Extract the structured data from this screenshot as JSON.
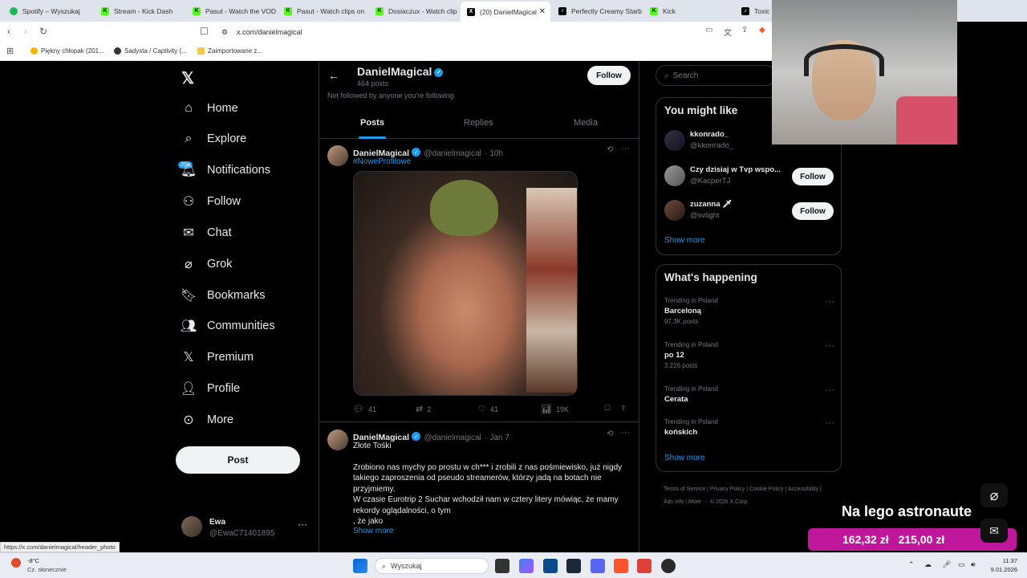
{
  "browser": {
    "tabs": [
      {
        "label": "Spotify – Wyszukaj",
        "color": "#1db954"
      },
      {
        "label": "Stream - Kick Dash",
        "color": "#53fc18"
      },
      {
        "label": "Pasut - Watch the VOD",
        "color": "#53fc18"
      },
      {
        "label": "Pasut - Watch clips on",
        "color": "#53fc18"
      },
      {
        "label": "Dosiaczux - Watch clip",
        "color": "#53fc18"
      },
      {
        "label": "(20) DanielMagical",
        "color": "#000000"
      },
      {
        "label": "Perfectly Creamy Starb",
        "color": "#000000"
      },
      {
        "label": "Kick",
        "color": "#53fc18"
      },
      {
        "label": "Toxic",
        "color": "#000000"
      }
    ],
    "url": "x.com/danielmagical",
    "bookmarks": [
      "Piękny chłopak (201...",
      "Sadysta / Captivity (...",
      "Zaimportowane z..."
    ],
    "status_url": "https://x.com/danielmagical/header_photo"
  },
  "sidebar": {
    "notifications_badge": "20+",
    "items": [
      {
        "label": "Home",
        "icon": "home-icon"
      },
      {
        "label": "Explore",
        "icon": "search-icon"
      },
      {
        "label": "Notifications",
        "icon": "bell-icon"
      },
      {
        "label": "Follow",
        "icon": "person-add-icon"
      },
      {
        "label": "Chat",
        "icon": "mail-icon"
      },
      {
        "label": "Grok",
        "icon": "grok-icon"
      },
      {
        "label": "Bookmarks",
        "icon": "bookmark-icon"
      },
      {
        "label": "Communities",
        "icon": "communities-icon"
      },
      {
        "label": "Premium",
        "icon": "x-logo-icon"
      },
      {
        "label": "Profile",
        "icon": "person-icon"
      },
      {
        "label": "More",
        "icon": "more-icon"
      }
    ],
    "post_button": "Post",
    "account": {
      "name": "Ewa",
      "handle": "@EwaC71401895"
    }
  },
  "profile": {
    "name": "DanielMagical",
    "posts_count": "464 posts",
    "follow_note": "Not followed by anyone you're following",
    "follow_button": "Follow",
    "tabs": [
      "Posts",
      "Replies",
      "Media"
    ]
  },
  "tweets": [
    {
      "name": "DanielMagical",
      "handle": "@danielmagical",
      "time": "· 10h",
      "hashtag": "#NoweProfilowe",
      "replies": "41",
      "reposts": "2",
      "likes": "41",
      "views": "19K"
    },
    {
      "name": "DanielMagical",
      "handle": "@danielmagical",
      "time": "· Jan 7",
      "title": "Złote Tośki",
      "body1": "Zrobiono nas mychy po prostu w ch*** i zrobili z nas pośmiewisko, już nigdy takiego zaproszenia od pseudo streamerów, którzy jadą na botach nie przyjmiemy.",
      "body2": "W czasie Eurotrip 2 Suchar wchodził nam w cztery litery mówiąc, że mamy rekordy oglądalności, o tym",
      "body3": ", że jako",
      "show_more": "Show more"
    }
  ],
  "right": {
    "search_placeholder": "Search",
    "you_might_like": "You might like",
    "suggestions": [
      {
        "name": "kkonrado_",
        "handle": "@kkonrado_"
      },
      {
        "name": "Czy dzisiaj w Tvp wspo...",
        "handle": "@KacperTJ",
        "button": "Follow"
      },
      {
        "name": "zuzanna 🗡",
        "handle": "@svlight",
        "button": "Follow"
      }
    ],
    "show_more": "Show more",
    "whats_happening": "What's happening",
    "trends": [
      {
        "context": "Trending in Poland",
        "topic": "Barceloną",
        "count": "97.3K posts"
      },
      {
        "context": "Trending in Poland",
        "topic": "po 12",
        "count": "3,226 posts"
      },
      {
        "context": "Trending in Poland",
        "topic": "Cerata",
        "count": ""
      },
      {
        "context": "Trending in Poland",
        "topic": "końskich",
        "count": ""
      }
    ],
    "show_more_2": "Show more",
    "footer": "Terms of Service | Privacy Policy | Cookie Policy | Accessibility | Ads info | More ··· © 2026 X Corp."
  },
  "overlay": {
    "donation_title": "Na lego astronaute",
    "amount_current": "162,32 zł",
    "amount_goal": "215,00 zł"
  },
  "taskbar": {
    "weather_temp": "-8°C",
    "weather_desc": "Cz. słonecznie",
    "search_placeholder": "Wyszukaj",
    "time": "11:37",
    "date": "9.01.2026"
  }
}
